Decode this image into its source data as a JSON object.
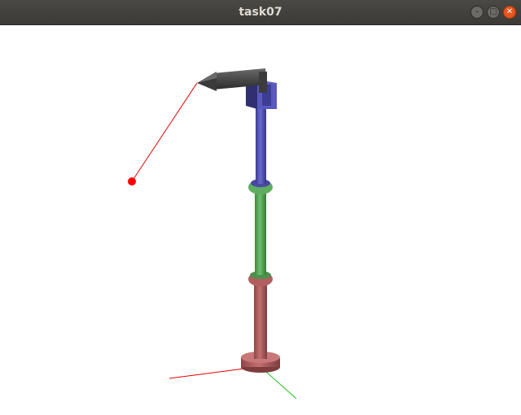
{
  "window": {
    "title": "task07",
    "controls": {
      "minimize_icon": "minimize-icon",
      "maximize_icon": "maximize-icon",
      "close_icon": "close-icon"
    }
  },
  "scene": {
    "background": "#ffffff",
    "target_color": "#ff0000",
    "link_colors": {
      "base": "#b35f5f",
      "middle": "#5fae5f",
      "upper": "#5e5ebd",
      "gripper": "#4a4a4a"
    },
    "axis_colors": {
      "x": "#e00000",
      "y": "#20c020"
    }
  }
}
